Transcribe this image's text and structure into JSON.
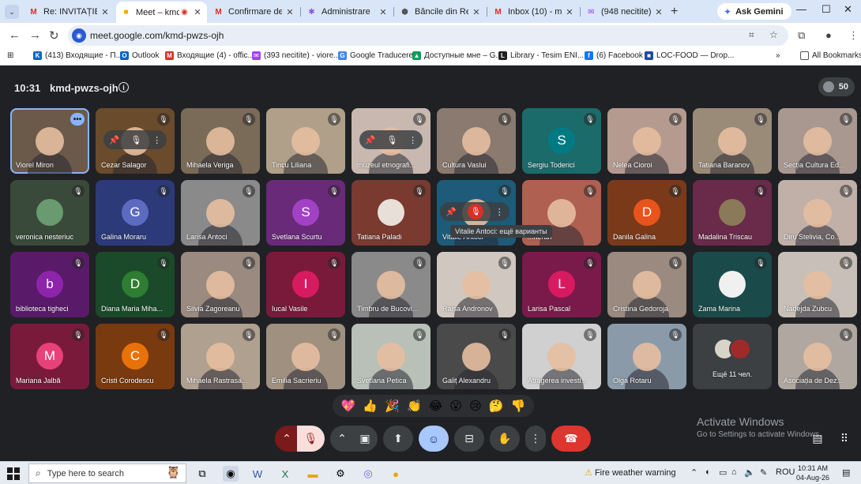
{
  "browser": {
    "tabs": [
      {
        "title": "Re: INVITAȚIE pen",
        "icon": "gmail-icon",
        "active": false
      },
      {
        "title": "Meet – kmd-p",
        "icon": "meet-icon",
        "active": true
      },
      {
        "title": "Confirmare depu",
        "icon": "gmail-icon",
        "active": false
      },
      {
        "title": "Administrare",
        "icon": "star-icon",
        "active": false
      },
      {
        "title": "Băncile din Repub",
        "icon": "bank-icon",
        "active": false
      },
      {
        "title": "Inbox (10) - mari",
        "icon": "gmail-icon",
        "active": false
      },
      {
        "title": "(948 necitite) - vio",
        "icon": "mail-icon",
        "active": false
      }
    ],
    "new_tab": "+",
    "gemini_label": "Ask Gemini",
    "url": "meet.google.com/kmd-pwzs-ojh",
    "bookmarks": [
      {
        "label": "(413) Входящие - П...",
        "color": "#1565c0",
        "glyph": "VK"
      },
      {
        "label": "Outlook",
        "color": "#0a64c9",
        "glyph": "O"
      },
      {
        "label": "Входящие (4) - offic...",
        "color": "#d93025",
        "glyph": "M"
      },
      {
        "label": "(393 necitite) - viore...",
        "color": "#a142f4",
        "glyph": "✉"
      },
      {
        "label": "Google Traducere",
        "color": "#4285f4",
        "glyph": "G"
      },
      {
        "label": "Доступные мне – G...",
        "color": "#0f9d58",
        "glyph": "▲"
      },
      {
        "label": "Library - Tesim ENI...",
        "color": "#222",
        "glyph": "L"
      },
      {
        "label": "(6) Facebook",
        "color": "#1877f2",
        "glyph": "f"
      },
      {
        "label": "LOC-FOOD — Drop...",
        "color": "#1a4ba0",
        "glyph": "■"
      }
    ],
    "all_bookmarks": "All Bookmarks"
  },
  "meet": {
    "time": "10:31",
    "code": "kmd-pwzs-ojh",
    "participant_count": "50",
    "tooltip": "Vitalie Antoci: ещё варианты",
    "more_label": "Ещё 11 чел.",
    "participants": [
      {
        "name": "Viorel Miron",
        "kind": "video",
        "bg": "#6b5a4a"
      },
      {
        "name": "Cezar Salagor",
        "kind": "video",
        "bg": "#6a4b2c"
      },
      {
        "name": "Mihaela Veriga",
        "kind": "video",
        "bg": "#7a6a58"
      },
      {
        "name": "Tincu Liliana",
        "kind": "video",
        "bg": "#b0a08a"
      },
      {
        "name": "muzeul etnografi...",
        "kind": "video",
        "bg": "#c8b8b0"
      },
      {
        "name": "Cultura Vaslui",
        "kind": "video",
        "bg": "#8a7a70"
      },
      {
        "name": "Sergiu Toderici",
        "kind": "avatar",
        "letter": "S",
        "bg": "#1b6b6b",
        "avbg": "#007b83"
      },
      {
        "name": "Nelea Cioroi",
        "kind": "video",
        "bg": "#b59a90"
      },
      {
        "name": "Tatiana Baranov",
        "kind": "video",
        "bg": "#9a8a78"
      },
      {
        "name": "Secția Cultura Ed...",
        "kind": "video",
        "bg": "#a89890"
      },
      {
        "name": "veronica nesteriuc",
        "kind": "image",
        "bg": "#3a4a3a",
        "avbg": "#6a9a70"
      },
      {
        "name": "Galina Moraru",
        "kind": "avatar",
        "letter": "G",
        "bg": "#2c3a7a",
        "avbg": "#5c6bc0"
      },
      {
        "name": "Larisa Antoci",
        "kind": "video",
        "bg": "#8a8a8a"
      },
      {
        "name": "Svetlana Scurtu",
        "kind": "avatar",
        "letter": "S",
        "bg": "#6a2a7a",
        "avbg": "#a142c4"
      },
      {
        "name": "Tatiana Paladi",
        "kind": "image",
        "bg": "#7a3a30",
        "avbg": "#e8e0d8"
      },
      {
        "name": "Vitalie Antoci",
        "kind": "video",
        "bg": "#1e5b78"
      },
      {
        "name": "...neran",
        "kind": "video",
        "bg": "#b06050"
      },
      {
        "name": "Danila Galina",
        "kind": "avatar",
        "letter": "D",
        "bg": "#7a3a1a",
        "avbg": "#e8541c"
      },
      {
        "name": "Madalina Triscau",
        "kind": "image",
        "bg": "#6a2a4a",
        "avbg": "#8a7a5a"
      },
      {
        "name": "Diru Stelivia, Co...",
        "kind": "video",
        "bg": "#c0b0a8"
      },
      {
        "name": "biblioteca tigheci",
        "kind": "avatar",
        "letter": "b",
        "bg": "#5a1a6a",
        "avbg": "#8e24aa"
      },
      {
        "name": "Diana Maria Miha...",
        "kind": "avatar",
        "letter": "D",
        "bg": "#1a4a2a",
        "avbg": "#2e7d32"
      },
      {
        "name": "Silvia Zagoreanu",
        "kind": "video",
        "bg": "#9a8a80"
      },
      {
        "name": "Iucal Vasile",
        "kind": "avatar",
        "letter": "I",
        "bg": "#7a1a3a",
        "avbg": "#d81b60"
      },
      {
        "name": "Timbru de Bucovi...",
        "kind": "video",
        "bg": "#8a8a8a"
      },
      {
        "name": "Raisa Andronov",
        "kind": "video",
        "bg": "#d0c8c0"
      },
      {
        "name": "Larisa Pascal",
        "kind": "avatar",
        "letter": "L",
        "bg": "#7a1a4a",
        "avbg": "#d81b60"
      },
      {
        "name": "Cristina Gedoroja",
        "kind": "video",
        "bg": "#9a8a80"
      },
      {
        "name": "Zama Marina",
        "kind": "image",
        "bg": "#1a4a4a",
        "avbg": "#f0f0f0"
      },
      {
        "name": "Nadejda Zubcu",
        "kind": "video",
        "bg": "#c8c0b8"
      },
      {
        "name": "Mariana Jalbă",
        "kind": "avatar",
        "letter": "M",
        "bg": "#7a1a3a",
        "avbg": "#e8417a"
      },
      {
        "name": "Cristi Corodescu",
        "kind": "avatar",
        "letter": "C",
        "bg": "#7a3a10",
        "avbg": "#e8710a"
      },
      {
        "name": "Mihaela Rastrasa...",
        "kind": "video",
        "bg": "#b0a090"
      },
      {
        "name": "Emilia Sacrieriu",
        "kind": "video",
        "bg": "#a09080"
      },
      {
        "name": "Svetlana Petica",
        "kind": "video",
        "bg": "#b8c0b8"
      },
      {
        "name": "Galiț Alexandru",
        "kind": "video",
        "bg": "#4a4a4a"
      },
      {
        "name": "Atragerea investi...",
        "kind": "video",
        "bg": "#d0d0d0"
      },
      {
        "name": "Olga Rotaru",
        "kind": "video",
        "bg": "#8a9aa8"
      },
      {
        "name": "Ещё 11 чел.",
        "kind": "more",
        "bg": "#3c4043"
      },
      {
        "name": "Asociația de Dez...",
        "kind": "video",
        "bg": "#b0a8a0"
      }
    ],
    "reactions": [
      "💖",
      "👍",
      "🎉",
      "👏",
      "😂",
      "😮",
      "😢",
      "🤔",
      "👎"
    ],
    "watermark_title": "Activate Windows",
    "watermark_sub": "Go to Settings to activate Windows."
  },
  "taskbar": {
    "search_placeholder": "Type here to search",
    "weather": "Fire weather warning",
    "lang": "ROU",
    "time": "10:31 AM",
    "date": "04-Aug-26"
  }
}
